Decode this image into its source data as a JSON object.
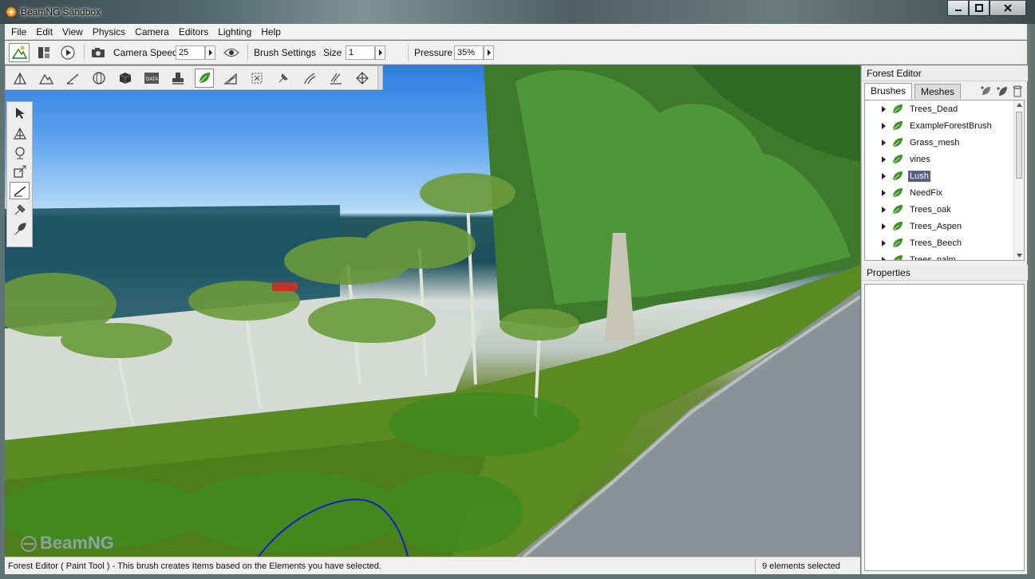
{
  "window": {
    "title": "BeamNG Sandbox"
  },
  "menu": [
    "File",
    "Edit",
    "View",
    "Physics",
    "Camera",
    "Editors",
    "Lighting",
    "Help"
  ],
  "toolbar": {
    "camera_speed_label": "Camera Speed",
    "camera_speed_value": "25",
    "brush_settings_label": "Brush Settings",
    "size_label": "Size",
    "size_value": "1",
    "pressure_label": "Pressure",
    "pressure_value": "35%"
  },
  "viewport": {
    "watermark": "BeamNG"
  },
  "status": {
    "text": "Forest Editor ( Paint Tool ) - This brush creates Items based on the Elements you have selected.",
    "count": "9 elements selected"
  },
  "forest_editor": {
    "title": "Forest Editor",
    "tabs": [
      "Brushes",
      "Meshes"
    ],
    "active_tab": "Brushes",
    "brushes": [
      "Trees_Dead",
      "ExampleForestBrush",
      "Grass_mesh",
      "vines",
      "Lush",
      "NeedFix",
      "Trees_oak",
      "Trees_Aspen",
      "Trees_Beech",
      "Trees_palm"
    ],
    "selected_brush": "Lush",
    "properties_title": "Properties"
  },
  "colors": {
    "accent_selection": "#5a5f82",
    "leaf_green": "#3f8f2a"
  }
}
